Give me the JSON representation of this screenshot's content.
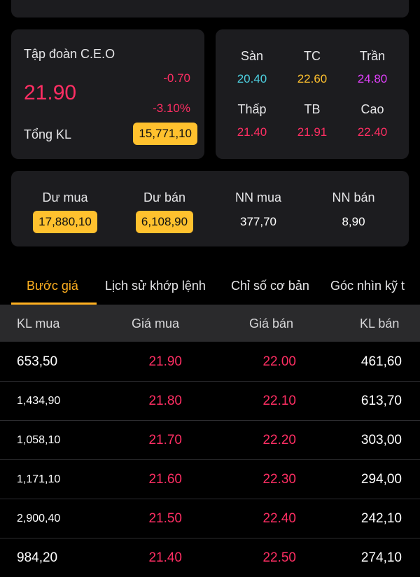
{
  "colors": {
    "down": "#ff2e63",
    "floor": "#4dd0e1",
    "ref": "#ffc12e",
    "ceiling": "#e040fb",
    "accent": "#ffb020",
    "badge": "#ffc12e"
  },
  "stock": {
    "name": "Tập đoàn C.E.O",
    "price": "21.90",
    "change": "-0.70",
    "change_pct": "-3.10%",
    "total_volume_label": "Tổng KL",
    "total_volume": "15,771,10"
  },
  "range": [
    {
      "label": "Sàn",
      "value": "20.40",
      "color": "#4dd0e1"
    },
    {
      "label": "TC",
      "value": "22.60",
      "color": "#ffc12e"
    },
    {
      "label": "Trần",
      "value": "24.80",
      "color": "#e040fb"
    },
    {
      "label": "Thấp",
      "value": "21.40",
      "color": "#ff2e63"
    },
    {
      "label": "TB",
      "value": "21.91",
      "color": "#ff2e63"
    },
    {
      "label": "Cao",
      "value": "22.40",
      "color": "#ff2e63"
    }
  ],
  "flow": [
    {
      "label": "Dư mua",
      "value": "17,880,10",
      "badge": true
    },
    {
      "label": "Dư bán",
      "value": "6,108,90",
      "badge": true
    },
    {
      "label": "NN mua",
      "value": "377,70",
      "badge": false
    },
    {
      "label": "NN bán",
      "value": "8,90",
      "badge": false
    }
  ],
  "tabs": [
    {
      "label": "Bước giá",
      "active": true
    },
    {
      "label": "Lịch sử khớp lệnh",
      "active": false
    },
    {
      "label": "Chỉ số cơ bản",
      "active": false
    },
    {
      "label": "Góc nhìn kỹ t",
      "active": false
    }
  ],
  "order_book": {
    "headers": [
      "KL mua",
      "Giá mua",
      "Giá bán",
      "KL bán"
    ],
    "rows": [
      {
        "bid_vol": "653,50",
        "bid": "21.90",
        "ask": "22.00",
        "ask_vol": "461,60"
      },
      {
        "bid_vol": "1,434,90",
        "bid": "21.80",
        "ask": "22.10",
        "ask_vol": "613,70"
      },
      {
        "bid_vol": "1,058,10",
        "bid": "21.70",
        "ask": "22.20",
        "ask_vol": "303,00"
      },
      {
        "bid_vol": "1,171,10",
        "bid": "21.60",
        "ask": "22.30",
        "ask_vol": "294,00"
      },
      {
        "bid_vol": "2,900,40",
        "bid": "21.50",
        "ask": "22.40",
        "ask_vol": "242,10"
      },
      {
        "bid_vol": "984,20",
        "bid": "21.40",
        "ask": "22.50",
        "ask_vol": "274,10"
      }
    ]
  }
}
